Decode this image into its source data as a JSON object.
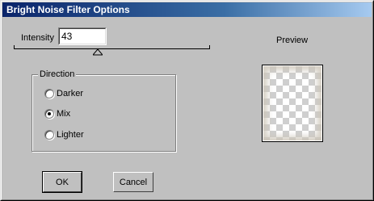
{
  "window": {
    "title": "Bright Noise Filter Options"
  },
  "intensity": {
    "label": "Intensity",
    "value": "43",
    "level": 43
  },
  "direction": {
    "label": "Direction",
    "options": [
      {
        "label": "Darker",
        "selected": false
      },
      {
        "label": "Mix",
        "selected": true
      },
      {
        "label": "Lighter",
        "selected": false
      }
    ]
  },
  "preview": {
    "label": "Preview"
  },
  "buttons": {
    "ok_label": "OK",
    "cancel_label": "Cancel"
  },
  "colors": {
    "title_start": "#0a246a",
    "title_end": "#a6caf0",
    "face": "#c0c0c0"
  }
}
